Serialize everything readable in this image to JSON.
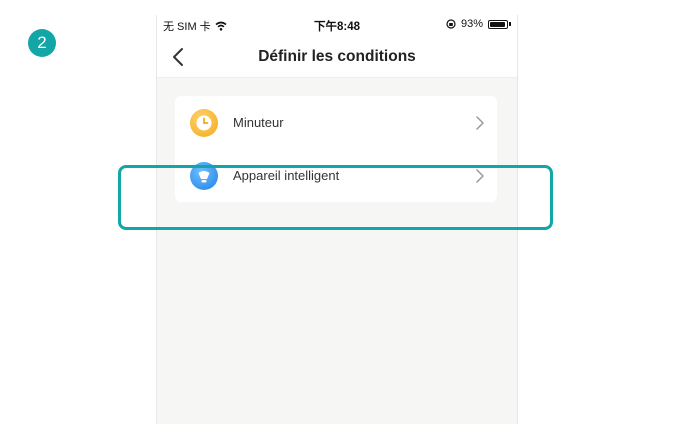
{
  "step": {
    "number": "2"
  },
  "status_bar": {
    "carrier": "无 SIM 卡",
    "time": "下午8:48",
    "battery_percent": "93%",
    "battery_level": 0.93
  },
  "header": {
    "title": "Définir les conditions"
  },
  "conditions": [
    {
      "label": "Minuteur",
      "icon": "timer-icon"
    },
    {
      "label": "Appareil intelligent",
      "icon": "smart-device-icon"
    }
  ],
  "colors": {
    "accent": "#13a6a6",
    "timer_icon": "#f3a91c",
    "device_icon": "#1f7fe6",
    "background": "#f6f6f4"
  }
}
